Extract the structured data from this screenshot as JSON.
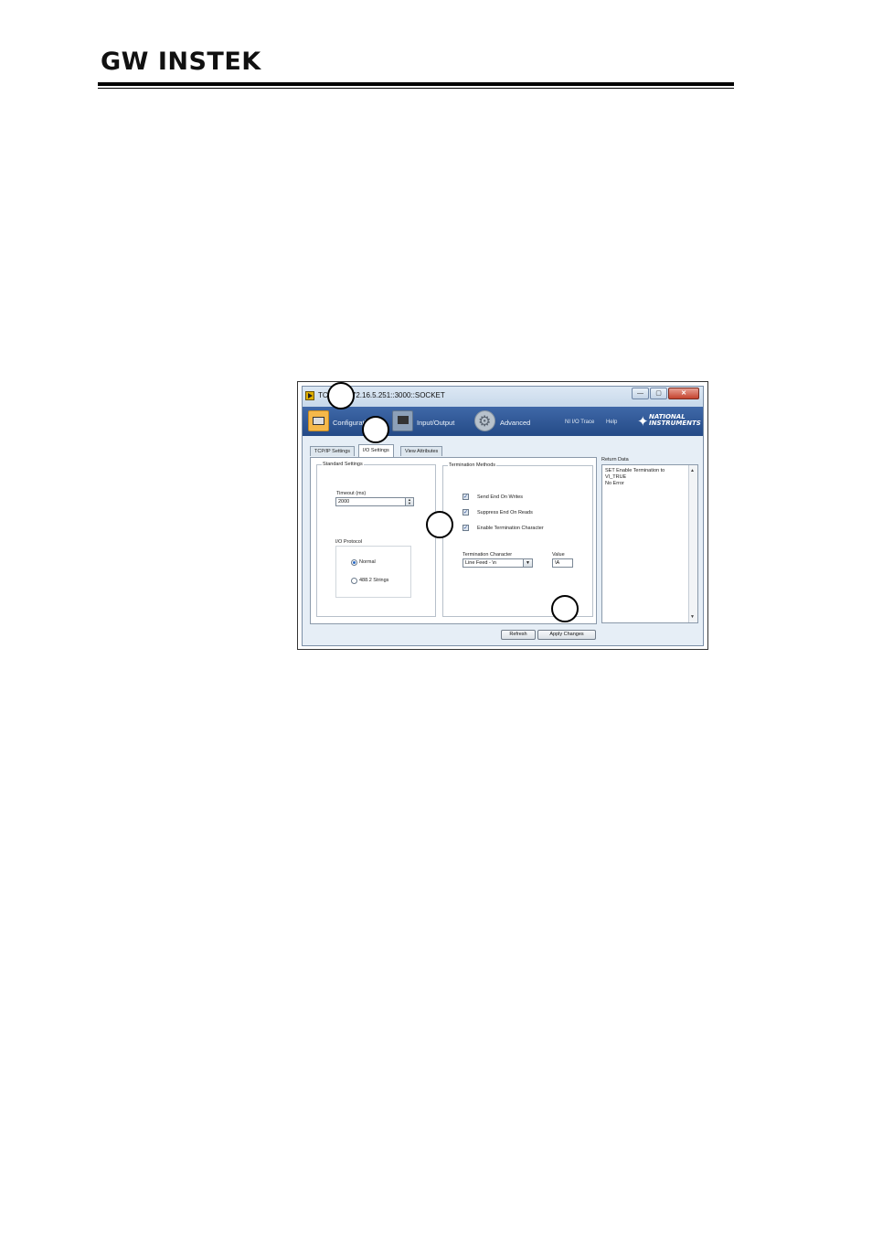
{
  "header": {
    "logo": "GW INSTEK"
  },
  "window": {
    "title": "TCPIP0::172.16.5.251::3000::SOCKET",
    "controls": {
      "minimize": "—",
      "maximize": "▢",
      "close": "✕"
    }
  },
  "toolbar": {
    "configuration": "Configuration",
    "input_output": "Input/Output",
    "advanced": "Advanced",
    "ni_io_trace": "NI I/O Trace",
    "help": "Help",
    "vendor_line1": "NATIONAL",
    "vendor_line2": "INSTRUMENTS"
  },
  "tabs": {
    "tcpip": "TCP/IP Settings",
    "io": "I/O Settings",
    "view": "View Attributes"
  },
  "standard": {
    "title": "Standard Settings",
    "timeout_label": "Timeout (ms)",
    "timeout_value": "2000",
    "protocol_label": "I/O Protocol",
    "normal": "Normal",
    "strings": "488.2 Strings"
  },
  "termination": {
    "title": "Termination Methods",
    "send_end": "Send End On Writes",
    "suppress_end": "Suppress End On Reads",
    "enable_term": "Enable Termination Character",
    "char_label": "Termination Character",
    "char_value": "Line Feed - \\n",
    "value_label": "Value",
    "value_value": "\\A"
  },
  "return_data": {
    "label": "Return Data",
    "line1": "SET Enable Termination to",
    "line2": "VI_TRUE",
    "line3": "No Error"
  },
  "buttons": {
    "refresh": "Refresh",
    "apply": "Apply Changes"
  }
}
